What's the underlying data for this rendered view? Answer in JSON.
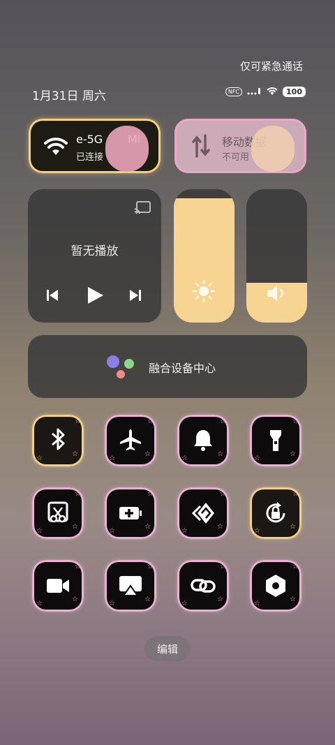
{
  "status": {
    "emergency": "仅可紧急通话",
    "date": "1月31日 周六",
    "nfc": "NFC",
    "battery": "100"
  },
  "wifi": {
    "title": "e-5G",
    "title2": "MI",
    "subtitle": "已连接"
  },
  "mobile_data": {
    "title": "移动数据",
    "subtitle": "不可用"
  },
  "media": {
    "label": "暂无播放"
  },
  "brightness": {
    "level": 0.93
  },
  "volume": {
    "level": 0.3
  },
  "fusion": {
    "label": "融合设备中心"
  },
  "colors": {
    "accent": "#f7d491",
    "pink_glow": "#e7b3d0",
    "gold_glow": "#f0cf86"
  },
  "toggles": [
    "bluetooth-icon",
    "airplane-icon",
    "bell-icon",
    "flashlight-icon",
    "screenshot-icon",
    "battery-saver-icon",
    "hotspot-icon",
    "rotation-lock-icon",
    "video-icon",
    "screencast-icon",
    "link-icon",
    "settings-hex-icon"
  ],
  "edit": {
    "label": "编辑"
  }
}
